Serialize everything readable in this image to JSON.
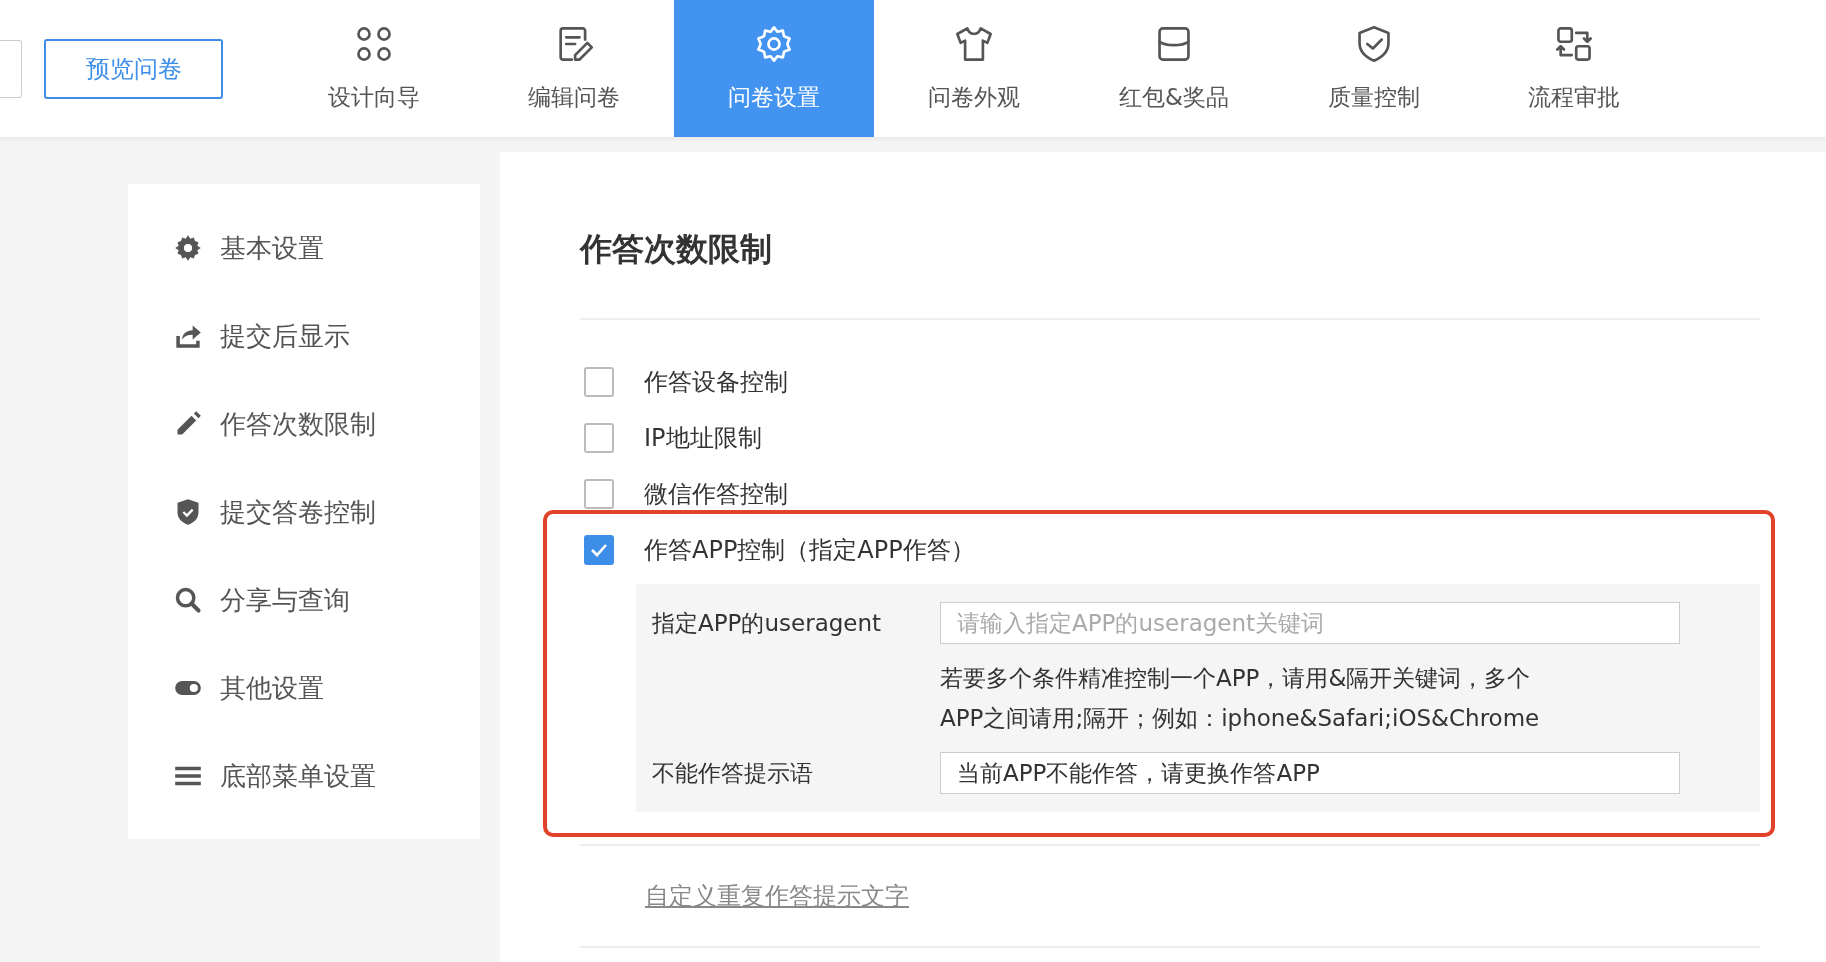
{
  "toolbar": {
    "preview_button": "预览问卷",
    "tabs": [
      {
        "label": "设计向导",
        "selected": false
      },
      {
        "label": "编辑问卷",
        "selected": false
      },
      {
        "label": "问卷设置",
        "selected": true
      },
      {
        "label": "问卷外观",
        "selected": false
      },
      {
        "label": "红包&奖品",
        "selected": false
      },
      {
        "label": "质量控制",
        "selected": false
      },
      {
        "label": "流程审批",
        "selected": false
      }
    ]
  },
  "sidebar": {
    "items": [
      {
        "label": "基本设置"
      },
      {
        "label": "提交后显示"
      },
      {
        "label": "作答次数限制"
      },
      {
        "label": "提交答卷控制"
      },
      {
        "label": "分享与查询"
      },
      {
        "label": "其他设置"
      },
      {
        "label": "底部菜单设置"
      }
    ]
  },
  "panel": {
    "title": "作答次数限制",
    "options": [
      {
        "label": "作答设备控制",
        "checked": false
      },
      {
        "label": "IP地址限制",
        "checked": false
      },
      {
        "label": "微信作答控制",
        "checked": false
      },
      {
        "label": "作答APP控制（指定APP作答）",
        "checked": true
      }
    ],
    "app_settings": {
      "useragent_label": "指定APP的useragent",
      "useragent_placeholder": "请输入指定APP的useragent关键词",
      "hint_lines": [
        "若要多个条件精准控制一个APP，请用&隔开关键词，多个",
        "APP之间请用;隔开；例如：iphone&Safari;iOS&Chrome"
      ],
      "message_label": "不能作答提示语",
      "message_value": "当前APP不能作答，请更换作答APP"
    },
    "custom_link": "自定义重复作答提示文字"
  }
}
